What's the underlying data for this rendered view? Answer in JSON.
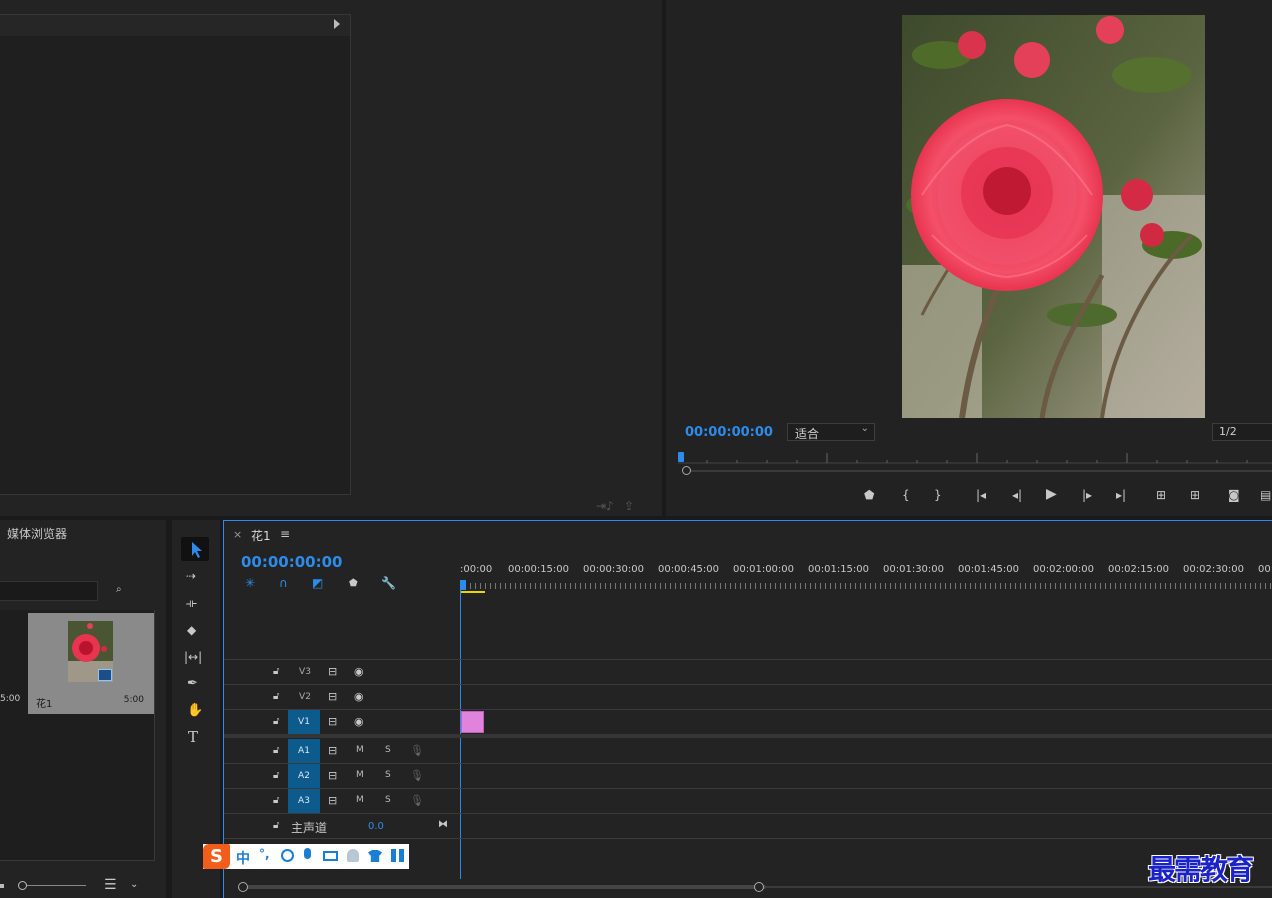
{
  "source_monitor": {
    "icons": [
      "triangle-right-icon",
      "insert-icon",
      "export-frame-icon"
    ]
  },
  "program_monitor": {
    "timecode": "00:00:00:00",
    "zoom_label": "适合",
    "resolution_label": "1/2",
    "preview_image": "flower-photo"
  },
  "project_panel": {
    "tab_label": "媒体浏览器",
    "left_clip_duration": "5:00",
    "clip_name": "花1",
    "clip_duration": "5:00"
  },
  "tools": [
    "selection-tool-icon",
    "track-select-tool-icon",
    "ripple-edit-tool-icon",
    "razor-tool-icon",
    "slip-tool-icon",
    "pen-tool-icon",
    "hand-tool-icon",
    "type-tool-icon"
  ],
  "timeline": {
    "close": "×",
    "sequence_name": "花1",
    "menu": "≡",
    "timecode": "00:00:00:00",
    "ruler_labels": [
      ":00:00",
      "00:00:15:00",
      "00:00:30:00",
      "00:00:45:00",
      "00:01:00:00",
      "00:01:15:00",
      "00:01:30:00",
      "00:01:45:00",
      "00:02:00:00",
      "00:02:15:00",
      "00:02:30:00",
      "00:"
    ],
    "video_tracks": [
      "V3",
      "V2",
      "V1"
    ],
    "audio_tracks": [
      "A1",
      "A2",
      "A3"
    ],
    "mute_label": "M",
    "solo_label": "S",
    "master_label": "主声道",
    "master_value": "0.0",
    "clip_color": "#e083dc"
  },
  "ime_toolbar": {
    "logo": "S",
    "language": "中",
    "punct": "°,",
    "icons": [
      "emoji-icon",
      "microphone-icon",
      "keyboard-icon",
      "user-icon",
      "shirt-icon",
      "grid-icon"
    ]
  },
  "watermark": "最需教育",
  "colors": {
    "accent": "#2d8ceb",
    "clip": "#e083dc",
    "track_active": "#0d5a8c"
  }
}
